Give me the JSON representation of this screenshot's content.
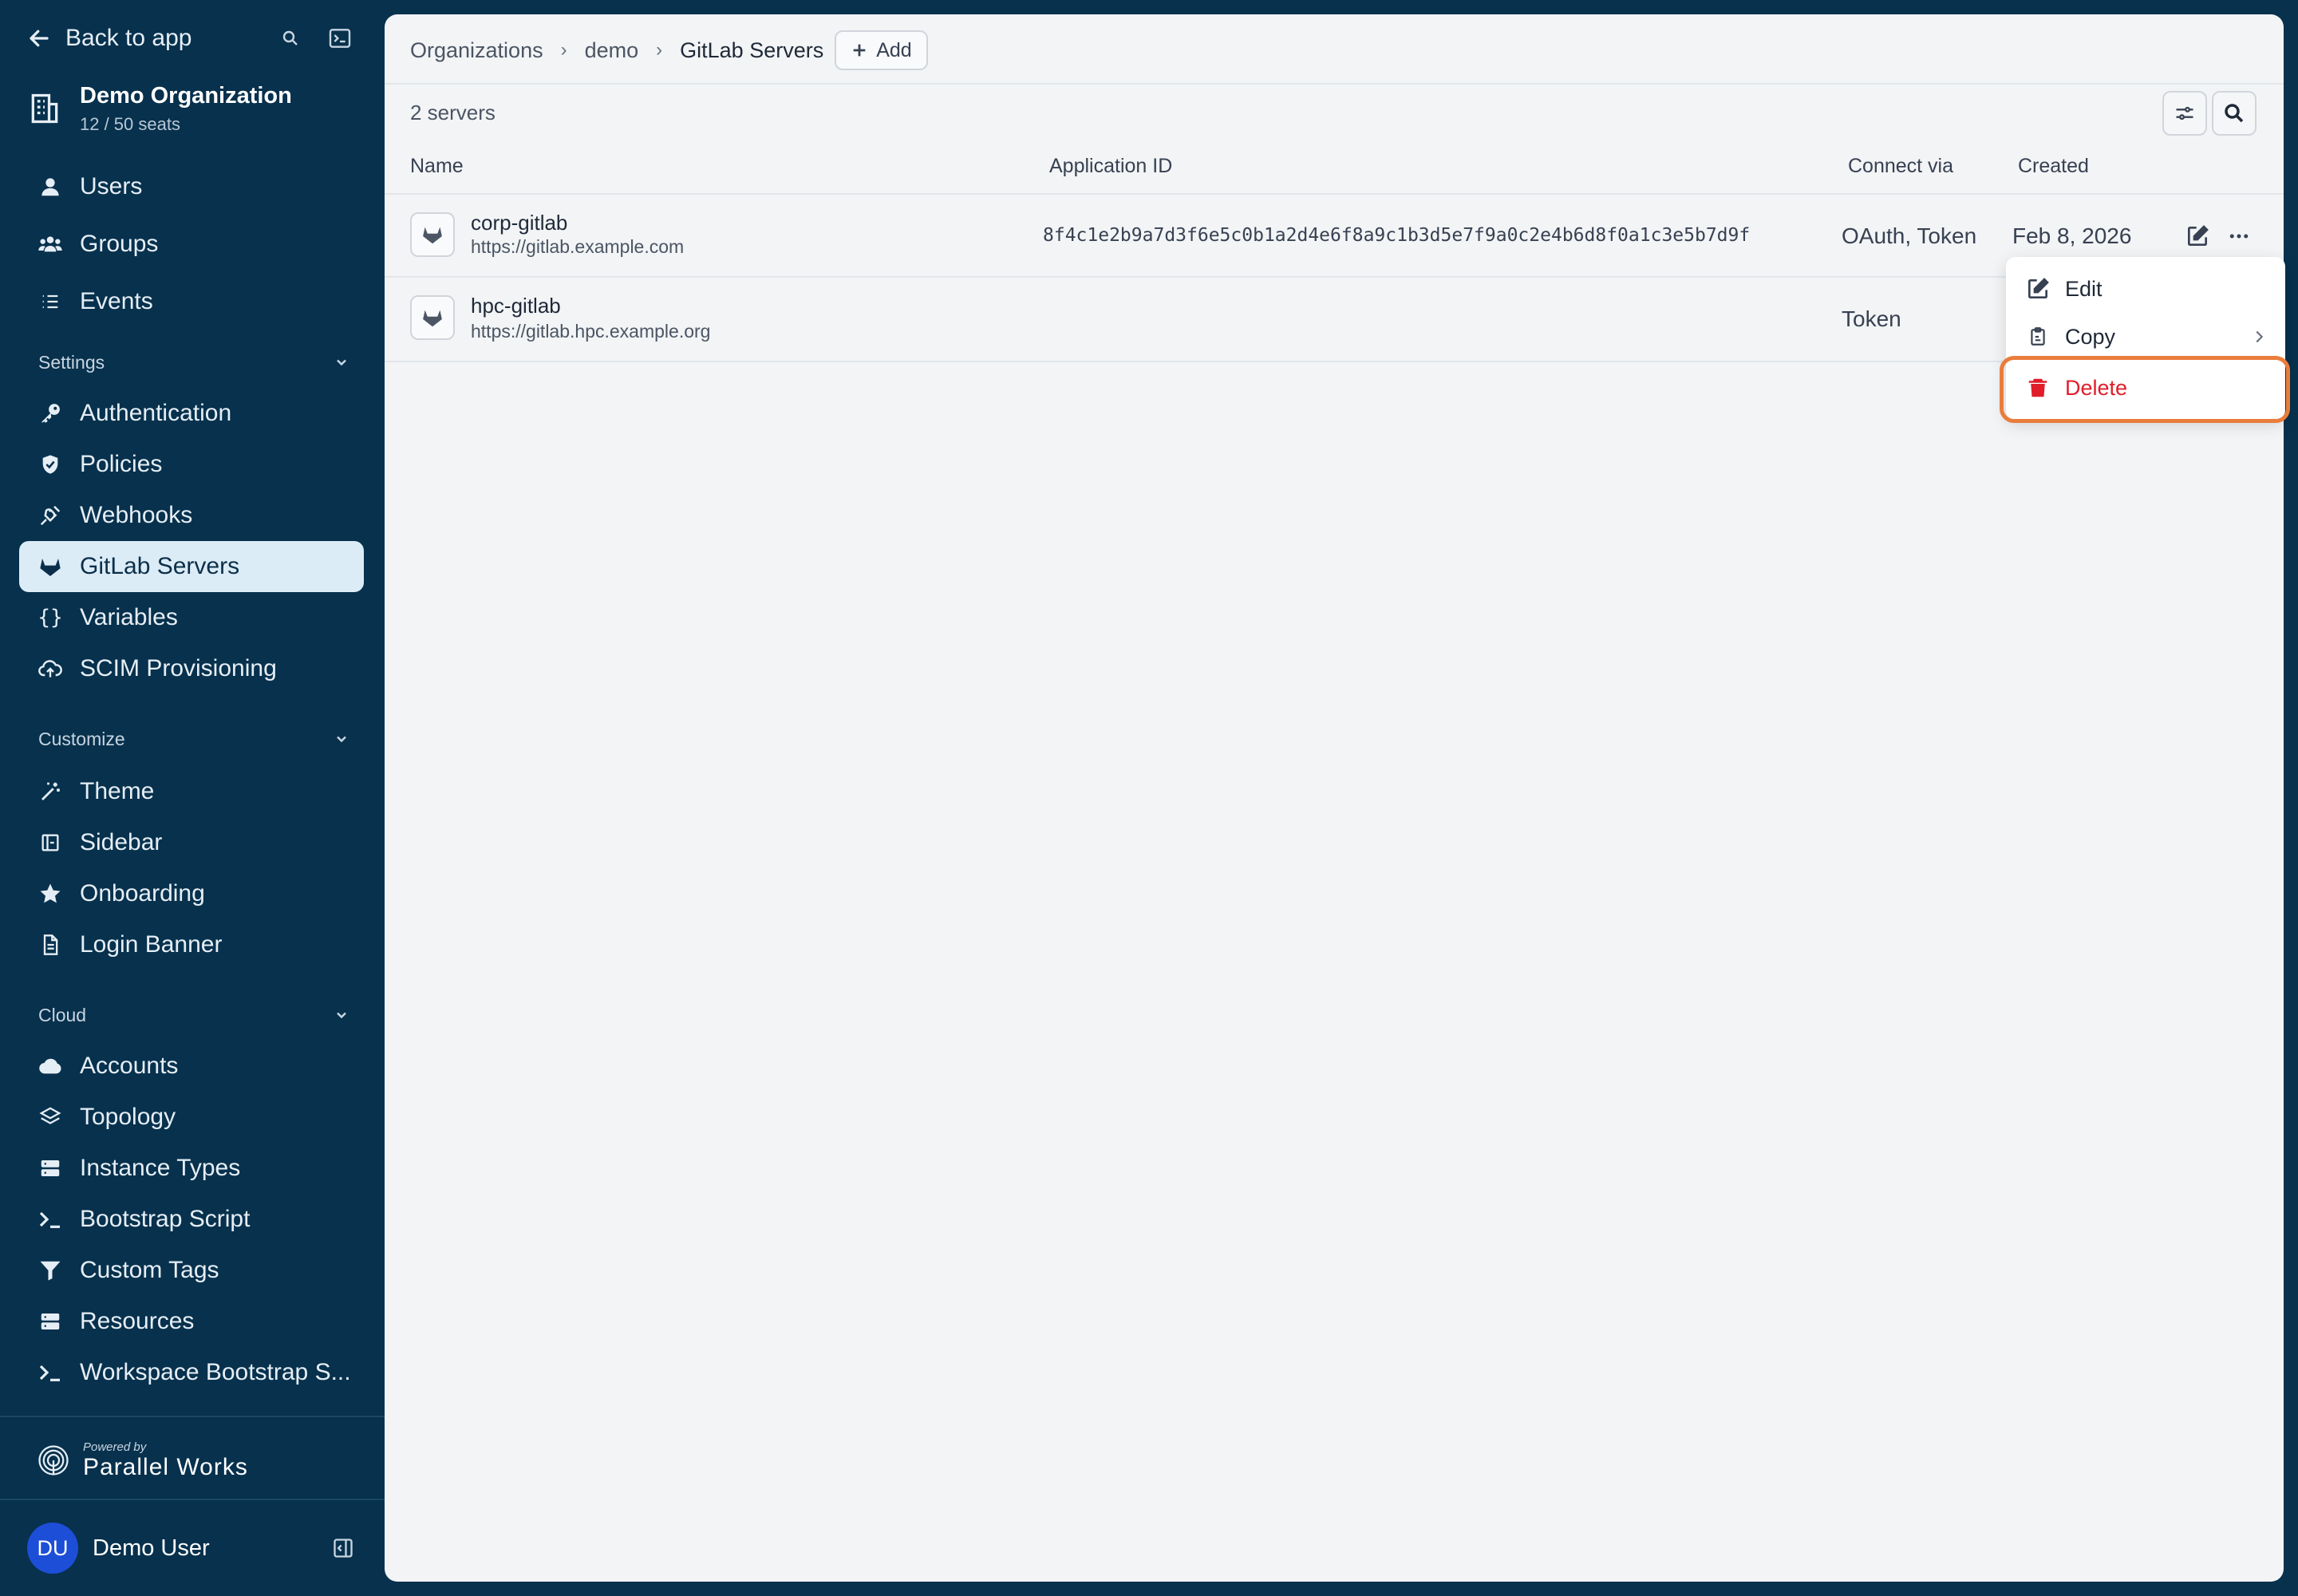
{
  "topbar": {
    "back_label": "Back to app"
  },
  "org": {
    "name": "Demo Organization",
    "seats": "12 / 50 seats"
  },
  "nav_main": [
    {
      "label": "Users",
      "icon": "user-icon"
    },
    {
      "label": "Groups",
      "icon": "groups-icon"
    },
    {
      "label": "Events",
      "icon": "list-icon"
    }
  ],
  "sections": {
    "settings": "Settings",
    "customize": "Customize",
    "cloud": "Cloud"
  },
  "nav_settings": [
    {
      "label": "Authentication",
      "icon": "key-icon"
    },
    {
      "label": "Policies",
      "icon": "shield-icon"
    },
    {
      "label": "Webhooks",
      "icon": "webhook-icon"
    },
    {
      "label": "GitLab Servers",
      "icon": "gitlab-icon",
      "active": true
    },
    {
      "label": "Variables",
      "icon": "braces-icon"
    },
    {
      "label": "SCIM Provisioning",
      "icon": "cloud-upload-icon"
    }
  ],
  "nav_customize": [
    {
      "label": "Theme",
      "icon": "wand-icon"
    },
    {
      "label": "Sidebar",
      "icon": "sidebar-icon"
    },
    {
      "label": "Onboarding",
      "icon": "star-icon"
    },
    {
      "label": "Login Banner",
      "icon": "file-icon"
    }
  ],
  "nav_cloud": [
    {
      "label": "Accounts",
      "icon": "cloud-icon"
    },
    {
      "label": "Topology",
      "icon": "layers-icon"
    },
    {
      "label": "Instance Types",
      "icon": "server-icon"
    },
    {
      "label": "Bootstrap Script",
      "icon": "terminal-icon"
    },
    {
      "label": "Custom Tags",
      "icon": "filter-icon"
    },
    {
      "label": "Resources",
      "icon": "server-icon"
    },
    {
      "label": "Workspace Bootstrap S...",
      "icon": "terminal-icon"
    }
  ],
  "brand": {
    "powered_by": "Powered by",
    "name": "Parallel Works"
  },
  "user": {
    "initials": "DU",
    "name": "Demo User"
  },
  "breadcrumb": [
    "Organizations",
    "demo",
    "GitLab Servers"
  ],
  "add_label": "Add",
  "count_label": "2 servers",
  "table": {
    "headers": {
      "name": "Name",
      "app_id": "Application ID",
      "connect": "Connect via",
      "created": "Created"
    },
    "rows": [
      {
        "name": "corp-gitlab",
        "url": "https://gitlab.example.com",
        "app_id": "8f4c1e2b9a7d3f6e5c0b1a2d4e6f8a9c1b3d5e7f9a0c2e4b6d8f0a1c3e5b7d9f",
        "connect": "OAuth, Token",
        "created": "Feb 8, 2026"
      },
      {
        "name": "hpc-gitlab",
        "url": "https://gitlab.hpc.example.org",
        "app_id": "",
        "connect": "Token",
        "created": ""
      }
    ]
  },
  "menu": {
    "edit": "Edit",
    "copy": "Copy",
    "delete": "Delete"
  },
  "colors": {
    "sidebar_bg": "#07314d",
    "active_bg": "#dcecf6",
    "delete": "#e11d2a",
    "highlight": "#ea7d3c"
  }
}
